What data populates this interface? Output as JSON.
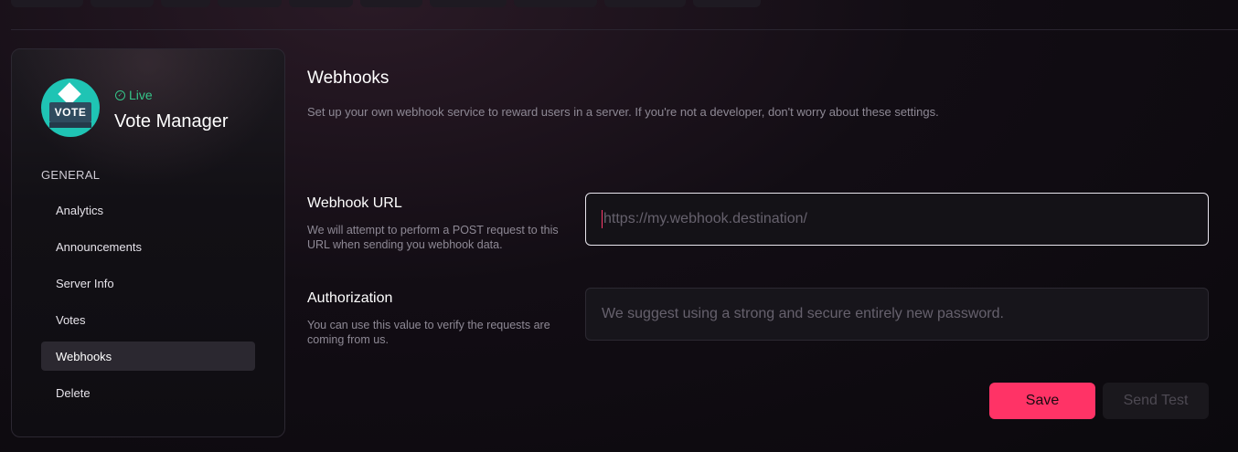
{
  "app": {
    "status": "Live",
    "name": "Vote Manager",
    "avatar_text": "VOTE"
  },
  "sidebar": {
    "section": "GENERAL",
    "items": [
      {
        "label": "Analytics"
      },
      {
        "label": "Announcements"
      },
      {
        "label": "Server Info"
      },
      {
        "label": "Votes"
      },
      {
        "label": "Webhooks",
        "active": true
      },
      {
        "label": "Delete"
      }
    ]
  },
  "main": {
    "title": "Webhooks",
    "description": "Set up your own webhook service to reward users in a server. If you're not a developer, don't worry about these settings.",
    "webhook_url": {
      "label": "Webhook URL",
      "help": "We will attempt to perform a POST request to this URL when sending you webhook data.",
      "placeholder": "https://my.webhook.destination/",
      "value": ""
    },
    "authorization": {
      "label": "Authorization",
      "help": "You can use this value to verify the requests are coming from us.",
      "placeholder": "We suggest using a strong and secure entirely new password.",
      "value": ""
    },
    "save_label": "Save",
    "send_test_label": "Send Test"
  },
  "colors": {
    "accent": "#ff3366",
    "live": "#35c68a",
    "avatar_bg": "#1fc4b4"
  }
}
